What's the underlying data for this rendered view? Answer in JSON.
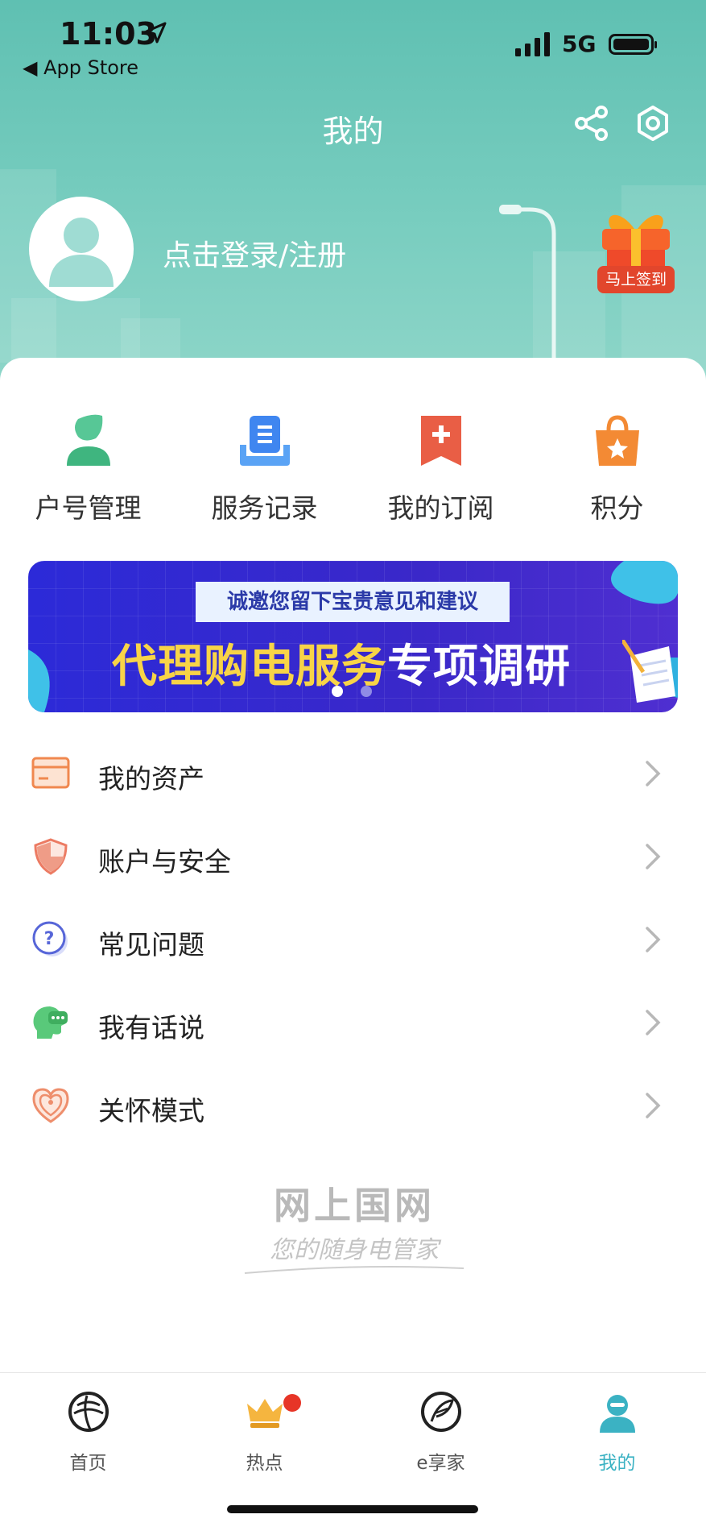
{
  "status_bar": {
    "time": "11:03",
    "back_label": "◀ App Store",
    "network": "5G"
  },
  "header": {
    "title": "我的",
    "login_text": "点击登录/注册",
    "checkin_label": "马上签到"
  },
  "quick_actions": [
    {
      "label": "户号管理",
      "icon": "account-manage-icon",
      "color": "#4cc08a"
    },
    {
      "label": "服务记录",
      "icon": "service-record-icon",
      "color": "#3f86f0"
    },
    {
      "label": "我的订阅",
      "icon": "subscription-icon",
      "color": "#e95e45"
    },
    {
      "label": "积分",
      "icon": "points-bag-icon",
      "color": "#f38a34"
    }
  ],
  "banner": {
    "subtitle": "诚邀您留下宝贵意见和建议",
    "title_yellow": "代理购电服务",
    "title_white": "专项调研",
    "slide_count": 2,
    "active_slide": 1
  },
  "menu": [
    {
      "label": "我的资产",
      "icon": "assets-card-icon"
    },
    {
      "label": "账户与安全",
      "icon": "shield-icon"
    },
    {
      "label": "常见问题",
      "icon": "question-icon"
    },
    {
      "label": "我有话说",
      "icon": "chat-head-icon"
    },
    {
      "label": "关怀模式",
      "icon": "care-heart-icon"
    }
  ],
  "footer_logo": {
    "name": "网上国网",
    "slogan": "您的随身电管家"
  },
  "tabbar": [
    {
      "label": "首页",
      "icon": "globe-home-icon",
      "active": false
    },
    {
      "label": "热点",
      "icon": "crown-icon",
      "active": false,
      "badge": true
    },
    {
      "label": "e享家",
      "icon": "feather-e-icon",
      "active": false
    },
    {
      "label": "我的",
      "icon": "user-tab-icon",
      "active": true
    }
  ],
  "colors": {
    "header": "#5fc0b2",
    "accent": "#3bb2c3",
    "badge": "#e73527",
    "banner_yellow": "#f8d447"
  }
}
